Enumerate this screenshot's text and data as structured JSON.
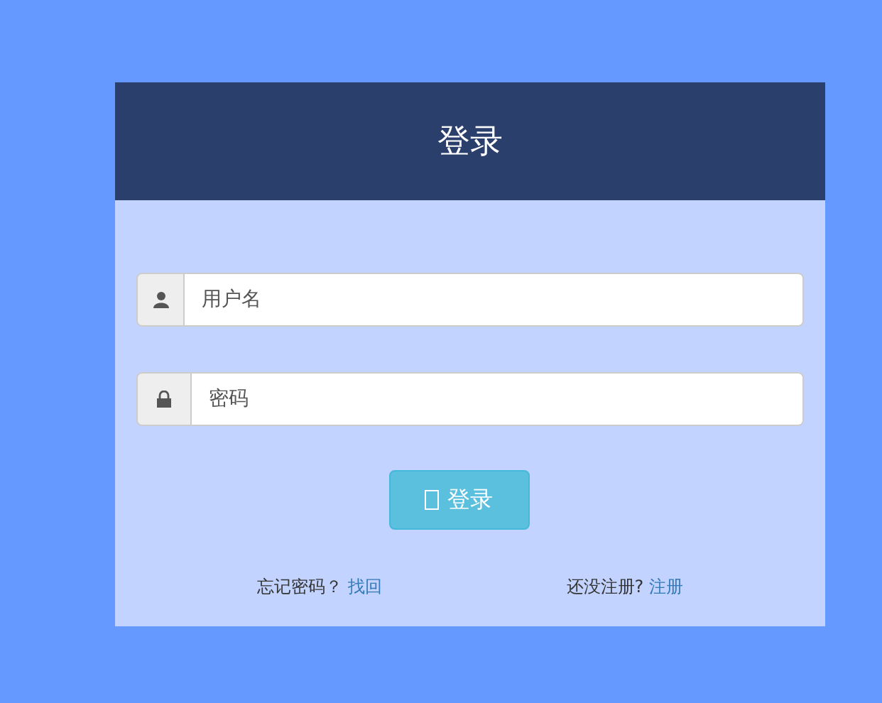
{
  "title": "登录",
  "fields": [
    {
      "kind": "user",
      "placeholder": "用户名"
    },
    {
      "kind": "password",
      "placeholder": "密码"
    }
  ],
  "submit": {
    "label": "登录"
  },
  "footer": {
    "forgot_text": "忘记密码？",
    "forgot_link": "找回",
    "register_text": "还没注册?",
    "register_link": "注册"
  }
}
